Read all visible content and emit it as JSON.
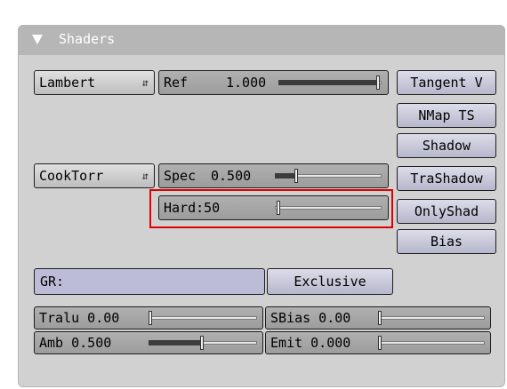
{
  "panel": {
    "title": "Shaders",
    "colors": {
      "panel_bg": "#d1d1d1",
      "header_bg": "#b6b6b6",
      "highlight": "#e00000"
    }
  },
  "diffuse": {
    "shader": "Lambert",
    "ref_label": "Ref",
    "ref_value": "1.000",
    "ref_level": 1.0
  },
  "specular": {
    "shader": "CookTorr",
    "spec_label": "Spec",
    "spec_value": "0.500",
    "spec_level": 0.25
  },
  "hard": {
    "label": "Hard:50",
    "level": 0.1
  },
  "toggles": [
    "Tangent V",
    "NMap TS",
    "Shadow",
    "TraShadow",
    "OnlyShad",
    "Bias"
  ],
  "group": {
    "field": "GR:",
    "exclusive": "Exclusive"
  },
  "bottom": {
    "tralu": {
      "label": "Tralu 0.00",
      "level": 0.0
    },
    "sbias": {
      "label": "SBias 0.00",
      "level": 0.0
    },
    "amb": {
      "label": "Amb 0.500",
      "level": 0.5
    },
    "emit": {
      "label": "Emit 0.000",
      "level": 0.0
    }
  }
}
